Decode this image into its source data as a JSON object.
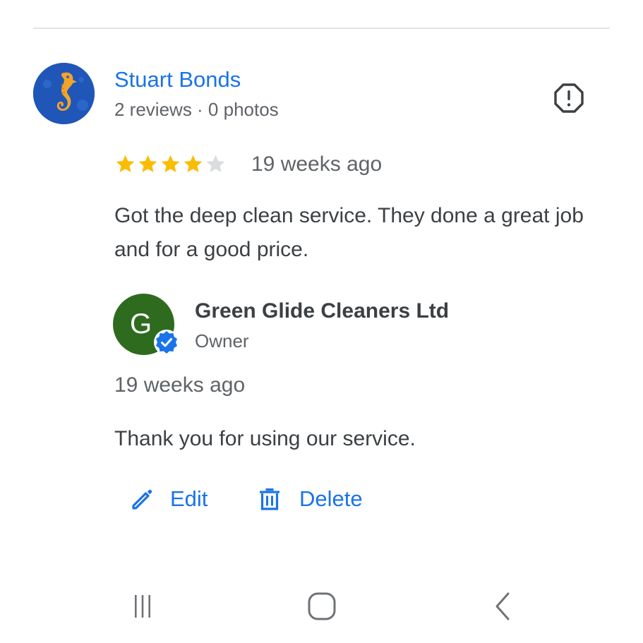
{
  "review": {
    "reviewer_name": "Stuart Bonds",
    "reviewer_meta": "2 reviews · 0 photos",
    "rating": 4,
    "rating_max": 5,
    "time": "19 weeks ago",
    "text": "Got the deep clean service. They done a great job and for a good price."
  },
  "owner_reply": {
    "avatar_letter": "G",
    "name": "Green Glide Cleaners Ltd",
    "role": "Owner",
    "time": "19 weeks ago",
    "text": "Thank you for using our service."
  },
  "actions": {
    "edit_label": "Edit",
    "delete_label": "Delete"
  },
  "icons": {
    "report": "report-flag-icon",
    "star": "star-icon",
    "verified": "verified-badge-icon",
    "edit": "pencil-icon",
    "delete": "trash-icon",
    "nav_recents": "recents-icon",
    "nav_home": "home-icon",
    "nav_back": "back-icon"
  },
  "colors": {
    "link_blue": "#1a73e8",
    "star_filled": "#fbbc04",
    "star_empty": "#dadce0",
    "owner_avatar": "#2e6b1f",
    "reviewer_avatar": "#1f56b8"
  }
}
